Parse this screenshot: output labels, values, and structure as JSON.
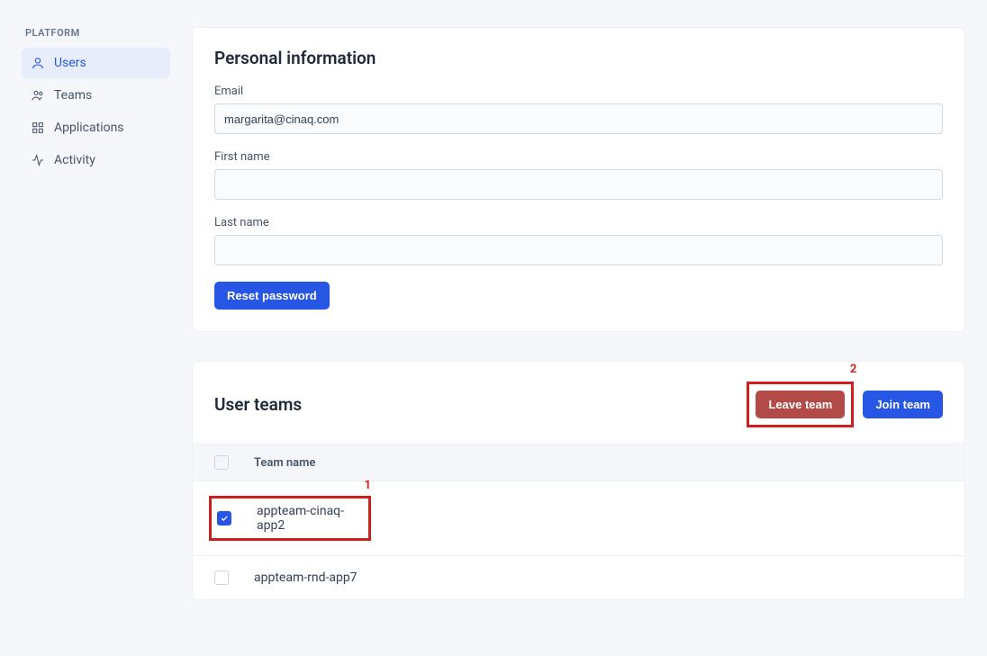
{
  "sidebar": {
    "heading": "PLATFORM",
    "items": [
      {
        "label": "Users",
        "active": true
      },
      {
        "label": "Teams",
        "active": false
      },
      {
        "label": "Applications",
        "active": false
      },
      {
        "label": "Activity",
        "active": false
      }
    ]
  },
  "personal": {
    "title": "Personal information",
    "email_label": "Email",
    "email_value": "margarita@cinaq.com",
    "first_name_label": "First name",
    "first_name_value": "",
    "last_name_label": "Last name",
    "last_name_value": "",
    "reset_password_label": "Reset password"
  },
  "teams": {
    "title": "User teams",
    "leave_label": "Leave team",
    "join_label": "Join team",
    "col_team_name": "Team name",
    "rows": [
      {
        "name": "appteam-cinaq-app2",
        "checked": true
      },
      {
        "name": "appteam-rnd-app7",
        "checked": false
      }
    ]
  },
  "annotations": {
    "num1": "1",
    "num2": "2"
  }
}
